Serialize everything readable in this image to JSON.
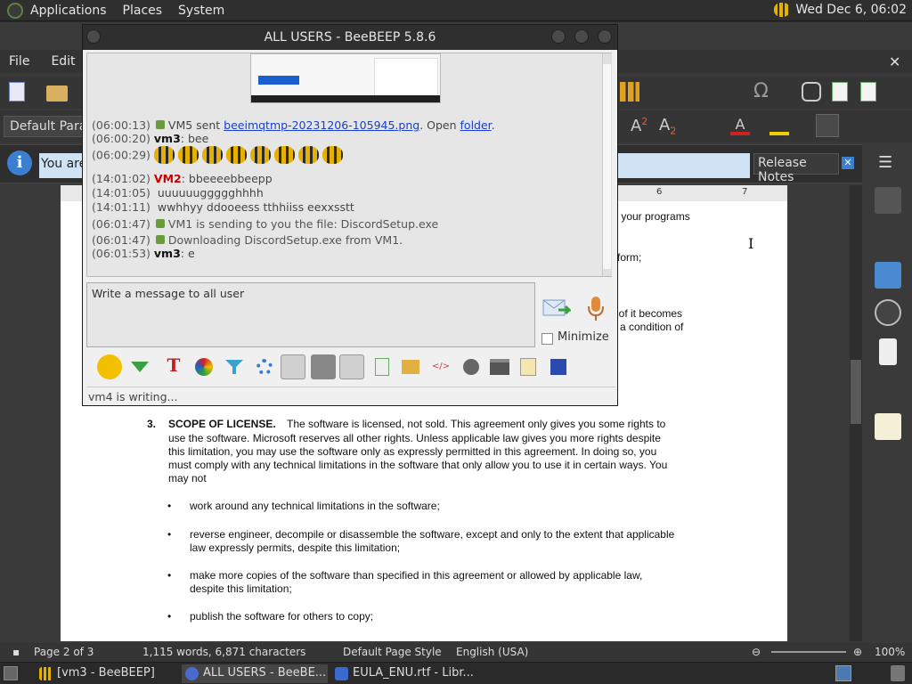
{
  "top_panel": {
    "menus": [
      "Applications",
      "Places",
      "System"
    ],
    "clock": "Wed Dec  6, 06:02"
  },
  "writer": {
    "menubar": [
      "File",
      "Edit"
    ],
    "paragraph_style": "Default Paragraph Style",
    "infobar_text": "You are",
    "release_notes_label": "Release Notes",
    "ruler_ticks": [
      "6",
      "7"
    ],
    "doc": {
      "fragment1": "s your programs",
      "fragment2": "form;",
      "fragment3": "t of it becomes",
      "fragment4": "a condition of",
      "section_number": "3.",
      "section_title": "SCOPE OF LICENSE.",
      "section_line1": "The software is licensed, not sold.  This agreement only gives you some rights to",
      "section_line2": "use the software.  Microsoft reserves all other rights.  Unless applicable law gives you more rights despite",
      "section_line3": "this limitation, you may use the software only as expressly permitted in this agreement.  In doing so, you",
      "section_line4": "must comply with any technical limitations in the software that only allow you to use it in certain ways.  You",
      "section_line5": "may not",
      "bullets": [
        {
          "l1": "work around any technical limitations in the software;",
          "l2": ""
        },
        {
          "l1": "reverse engineer, decompile or disassemble the software, except and only to the extent that applicable",
          "l2": "law expressly permits, despite this limitation;"
        },
        {
          "l1": "make more copies of the software than specified in this agreement or allowed by applicable law,",
          "l2": "despite this limitation;"
        },
        {
          "l1": "publish the software for others to copy;",
          "l2": ""
        }
      ]
    },
    "statusbar": {
      "page": "Page 2 of 3",
      "words": "1,115 words, 6,871 characters",
      "page_style": "Default Page Style",
      "language": "English (USA)",
      "zoom": "100%"
    }
  },
  "beebeep": {
    "title": "ALL USERS - BeeBEEP 5.8.6",
    "messages": [
      {
        "ts": "(06:00:13)",
        "pre": "VM5 sent ",
        "link": "beeimqtmp-20231206-105945.png",
        "mid": ". Open ",
        "link2": "folder",
        "post": "."
      },
      {
        "ts": "(06:00:20)",
        "nick": "vm3",
        "text": ": bee"
      },
      {
        "ts": "(06:00:29)"
      },
      {
        "ts": "(14:01:02)",
        "nick": "VM2",
        "text": ": bbeeeebbeepp"
      },
      {
        "ts": "(14:01:05)",
        "text": "uuuuuuggggghhhh"
      },
      {
        "ts": "(14:01:11)",
        "text": "wwhhyy  ddooeess  tthhiiss  eexxsstt"
      },
      {
        "ts": "(06:01:47)",
        "sys": "VM1 is sending to you the file: DiscordSetup.exe"
      },
      {
        "ts": "(06:01:47)",
        "sys": "Downloading DiscordSetup.exe from VM1."
      },
      {
        "ts": "(06:01:53)",
        "nick": "vm3",
        "text": ": e"
      }
    ],
    "input_placeholder": "Write a message to all user",
    "minimize_label": "Minimize",
    "status": "vm4 is writing..."
  },
  "taskbar": {
    "tasks": [
      "[vm3 - BeeBEEP]",
      "ALL USERS - BeeBE...",
      "EULA_ENU.rtf - Libr..."
    ]
  }
}
